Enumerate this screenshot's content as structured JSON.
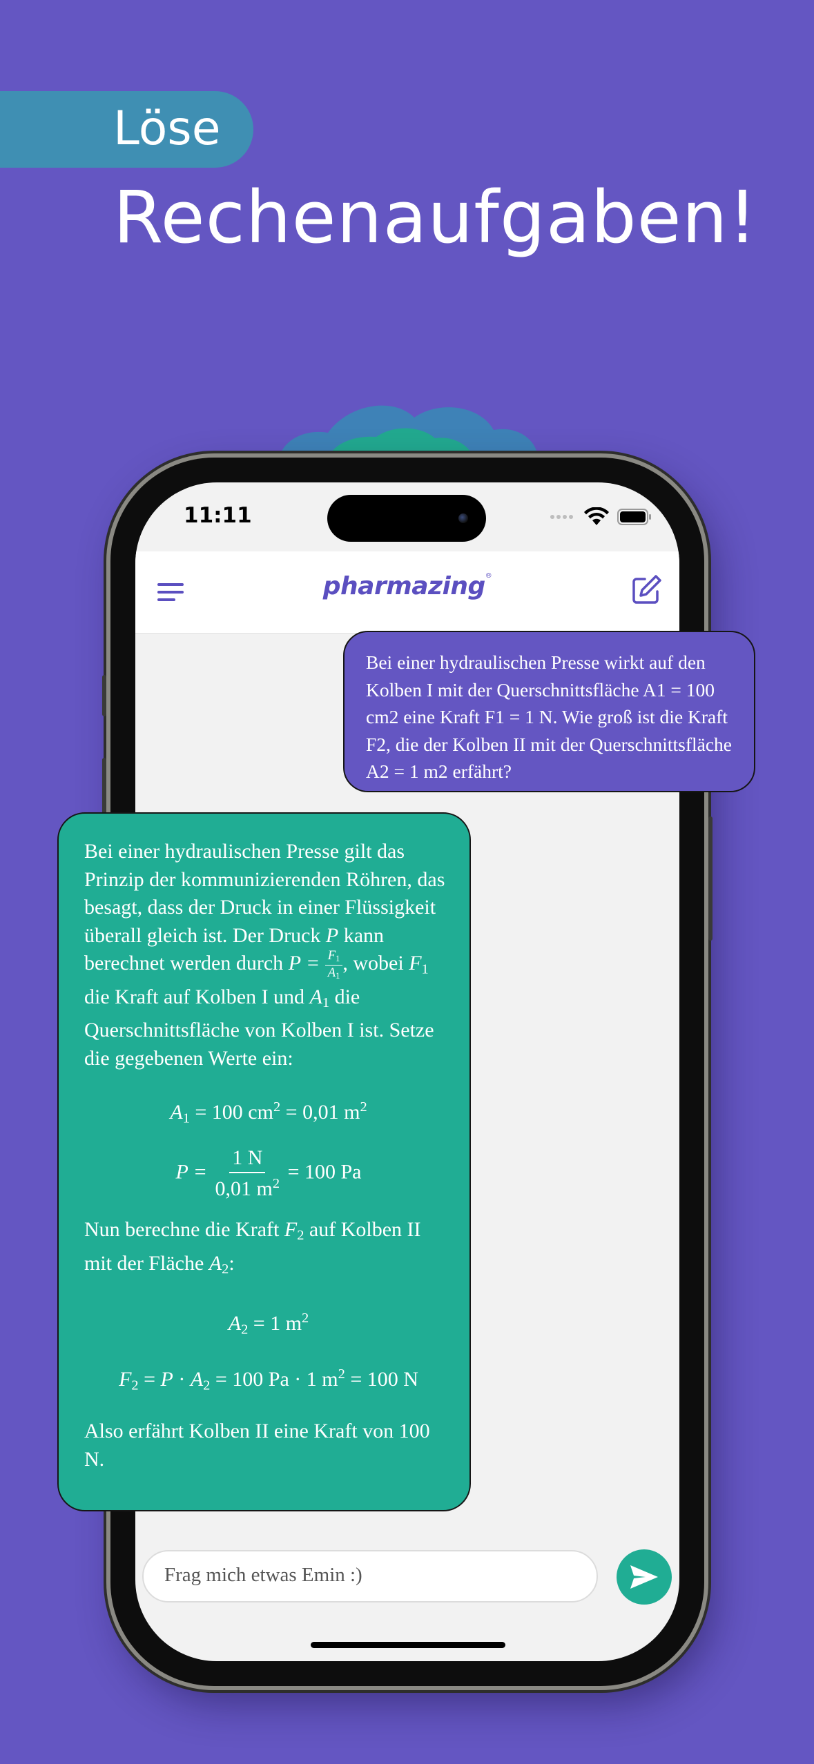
{
  "headline": {
    "line1": "Löse",
    "line2": "Rechenaufgaben!"
  },
  "status_bar": {
    "time": "11:11"
  },
  "app": {
    "brand": "pharmazing",
    "registered_mark": "®"
  },
  "chat": {
    "user_message": "Bei einer hydraulischen Presse wirkt auf den Kolben I mit der Querschnittsfläche A1 = 100 cm2 eine Kraft F1 = 1 N. Wie groß ist die Kraft F2, die der Kolben II mit der Querschnittsfläche A2 = 1 m2 erfährt?",
    "bot_message": {
      "intro_1": "Bei einer hydraulischen Presse gilt das Prinzip der kommunizierenden Röhren, das besagt, dass der Druck in einer Flüssigkeit überall gleich ist. Der Druck ",
      "var_P": "P",
      "intro_2": " kann berechnet werden durch ",
      "eq_lhs": "P =",
      "frac_num": "F",
      "frac_den": "A",
      "idx_1": "1",
      "idx_2": "2",
      "intro_3": ", wobei ",
      "var_F": "F",
      "intro_4": " die Kraft auf Kolben I und ",
      "var_A": "A",
      "intro_5": " die Querschnittsfläche von Kolben I ist. Setze die gegebenen Werte ein:",
      "eq_a1_rhs": " = 100 cm",
      "eq_a1_rhs2": " = 0,01 m",
      "pow_2": "2",
      "eq_p_num": "1 N",
      "eq_p_den": "0,01 m",
      "eq_p_rhs": " = 100 Pa",
      "middle_1": "Nun berechne die Kraft ",
      "middle_2": " auf Kolben II mit der Fläche ",
      "middle_3": ":",
      "eq_a2_rhs": " = 1 m",
      "eq_f2_eq": " = ",
      "eq_f2_dot": " · ",
      "eq_f2_rhs1": " = 100 Pa · 1 m",
      "eq_f2_rhs2": " = 100 N",
      "conclusion": "Also erfährt Kolben II eine Kraft von 100 N."
    }
  },
  "input": {
    "placeholder": "Frag mich etwas Emin :)"
  },
  "colors": {
    "background": "#6456c2",
    "accent_teal": "#20ad94",
    "pill": "#3f8fb3",
    "brand": "#5b4fc0"
  },
  "icons": [
    "menu-icon",
    "compose-icon",
    "wifi-icon",
    "battery-icon",
    "cellular-icon",
    "send-icon"
  ]
}
